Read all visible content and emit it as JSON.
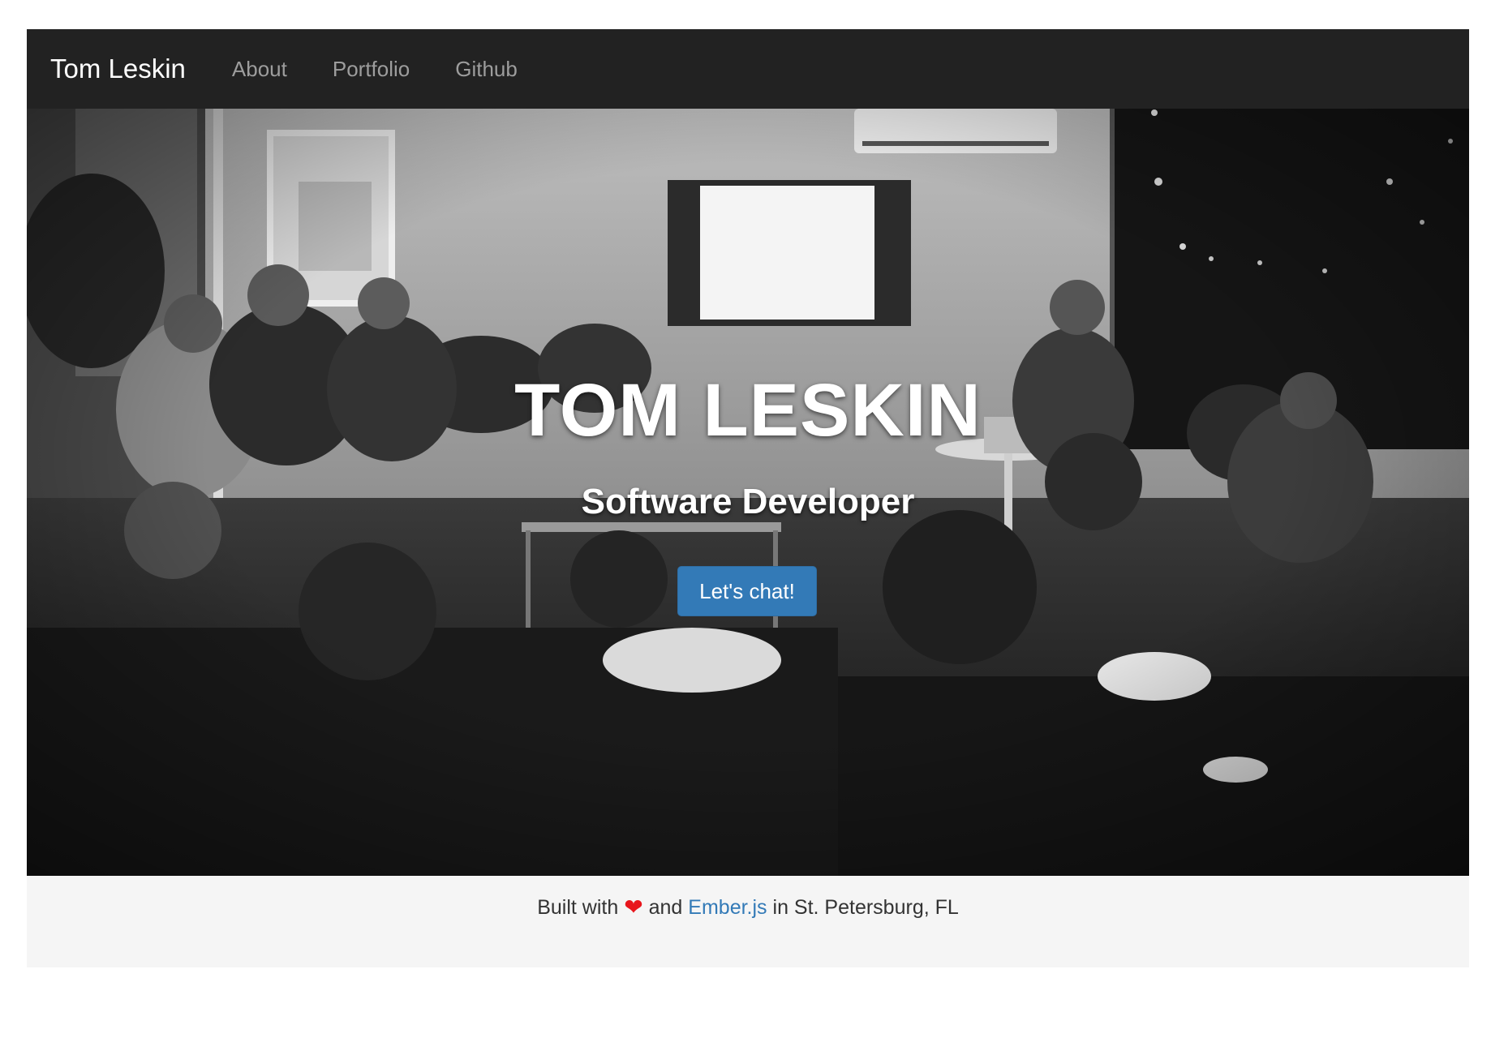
{
  "navbar": {
    "brand": "Tom Leskin",
    "links": [
      "About",
      "Portfolio",
      "Github"
    ]
  },
  "hero": {
    "title": "TOM LESKIN",
    "subtitle": "Software Developer",
    "cta_label": "Let's chat!"
  },
  "footer": {
    "prefix": "Built with",
    "heart": "❤",
    "and": "and",
    "link_text": "Ember.js",
    "suffix": "in St. Petersburg, FL"
  },
  "colors": {
    "navbar_bg": "#222222",
    "cta_bg": "#337ab7",
    "link": "#337ab7",
    "heart": "#e8161c",
    "footer_bg": "#f5f5f5"
  }
}
